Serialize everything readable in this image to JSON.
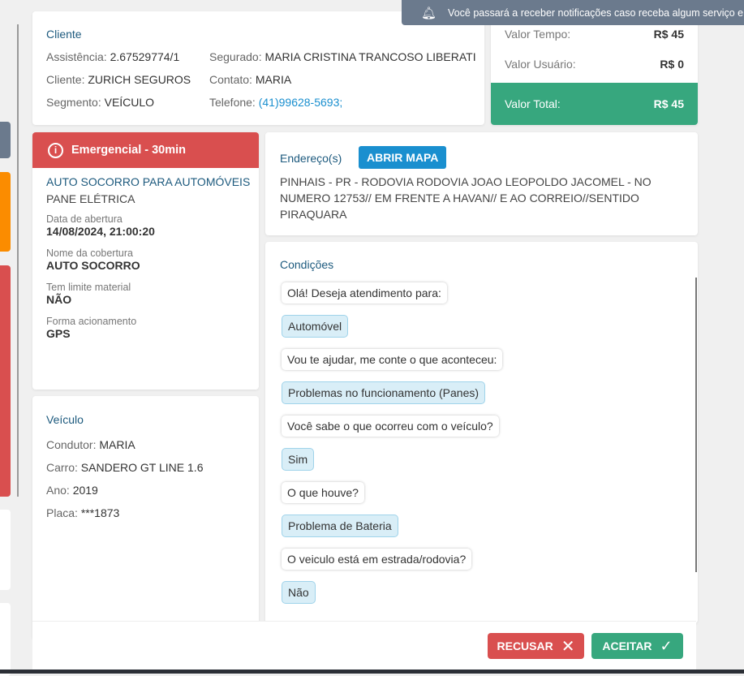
{
  "notification": {
    "text": "Você passará a receber notificações caso receba algum serviço e"
  },
  "cliente": {
    "title": "Cliente",
    "assistencia_label": "Assistência:",
    "assistencia": "2.67529774/1",
    "cliente_label": "Cliente:",
    "cliente": "ZURICH SEGUROS",
    "segmento_label": "Segmento:",
    "segmento": "VEÍCULO",
    "segurado_label": "Segurado:",
    "segurado": "MARIA CRISTINA TRANCOSO LIBERATI",
    "contato_label": "Contato:",
    "contato": "MARIA",
    "telefone_label": "Telefone:",
    "telefone": "(41)99628-5693;"
  },
  "valores": {
    "tempo_label": "Valor Tempo:",
    "tempo": "R$ 45",
    "usuario_label": "Valor Usuário:",
    "usuario": "R$ 0",
    "total_label": "Valor Total:",
    "total": "R$ 45"
  },
  "servico": {
    "badge": "Emergencial - 30min",
    "tipo": "AUTO SOCORRO PARA AUTOMÓVEIS",
    "subtipo": "PANE ELÉTRICA",
    "data_label": "Data de abertura",
    "data": "14/08/2024, 21:00:20",
    "cobertura_label": "Nome da cobertura",
    "cobertura": "AUTO SOCORRO",
    "limite_label": "Tem limite material",
    "limite": "NÃO",
    "forma_label": "Forma acionamento",
    "forma": "GPS"
  },
  "veiculo": {
    "title": "Veículo",
    "condutor_label": "Condutor:",
    "condutor": "MARIA",
    "carro_label": "Carro:",
    "carro": "SANDERO GT LINE 1.6",
    "ano_label": "Ano:",
    "ano": "2019",
    "placa_label": "Placa:",
    "placa": "***1873"
  },
  "endereco": {
    "title": "Endereço(s)",
    "map_button": "ABRIR MAPA",
    "text": "PINHAIS - PR - RODOVIA RODOVIA JOAO LEOPOLDO JACOMEL - NO NUMERO 12753// EM FRENTE A HAVAN// E AO CORREIO//SENTIDO PIRAQUARA"
  },
  "condicoes": {
    "title": "Condições",
    "messages": [
      {
        "text": "Olá! Deseja atendimento para:",
        "answer": false
      },
      {
        "text": "Automóvel",
        "answer": true
      },
      {
        "text": "Vou te ajudar, me conte o que aconteceu:",
        "answer": false
      },
      {
        "text": "Problemas no funcionamento (Panes)",
        "answer": true
      },
      {
        "text": "Você sabe o que ocorreu com o veículo?",
        "answer": false
      },
      {
        "text": "Sim",
        "answer": true
      },
      {
        "text": "O que houve?",
        "answer": false
      },
      {
        "text": "Problema de Bateria",
        "answer": true
      },
      {
        "text": "O veiculo está em estrada/rodovia?",
        "answer": false
      },
      {
        "text": "Não",
        "answer": true
      }
    ]
  },
  "actions": {
    "recusar": "RECUSAR",
    "aceitar": "ACEITAR"
  },
  "colors": {
    "red": "#d94f4f",
    "green": "#37a77e",
    "blue": "#1a8fcf",
    "title": "#1d5a7e"
  }
}
